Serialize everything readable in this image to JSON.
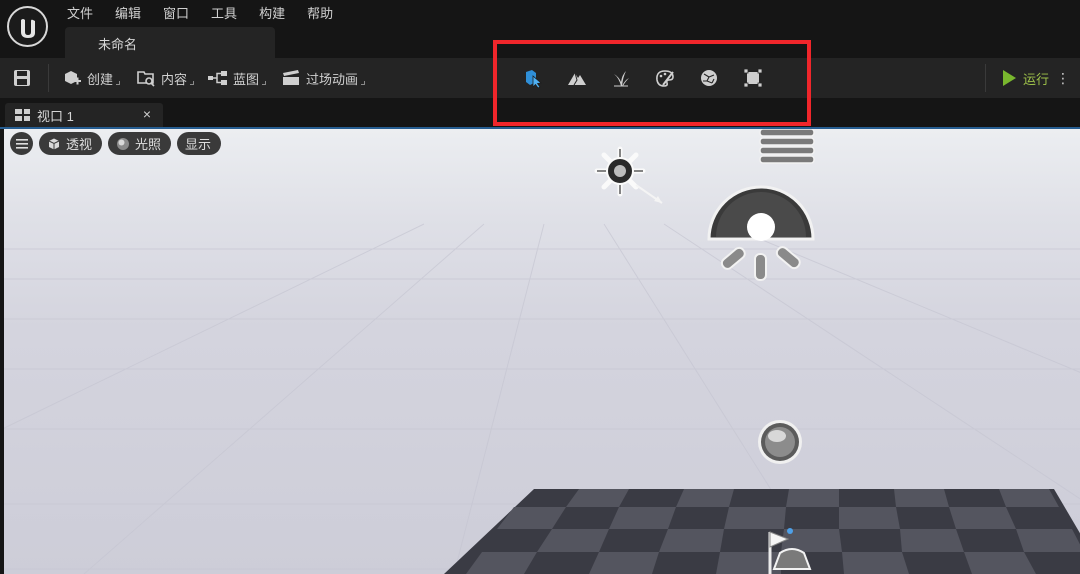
{
  "app": {
    "logo_icon": "unreal-engine-logo",
    "menu": [
      "文件",
      "编辑",
      "窗口",
      "工具",
      "构建",
      "帮助"
    ],
    "document_tab": "未命名"
  },
  "toolbar": {
    "save_icon": "save-icon",
    "create_label": "创建",
    "content_label": "内容",
    "blueprint_label": "蓝图",
    "cinematics_label": "过场动画",
    "modes": [
      "select-mode-icon",
      "landscape-mode-icon",
      "foliage-mode-icon",
      "mesh-paint-mode-icon",
      "fracture-mode-icon",
      "brush-edit-mode-icon"
    ],
    "run_label": "运行",
    "accent_color": "#79b72e"
  },
  "viewport": {
    "tab_label": "视口 1",
    "close_glyph": "×",
    "pills": {
      "perspective_label": "透视",
      "lighting_label": "光照",
      "show_label": "显示"
    }
  },
  "highlight": {
    "color": "#f0262b"
  }
}
